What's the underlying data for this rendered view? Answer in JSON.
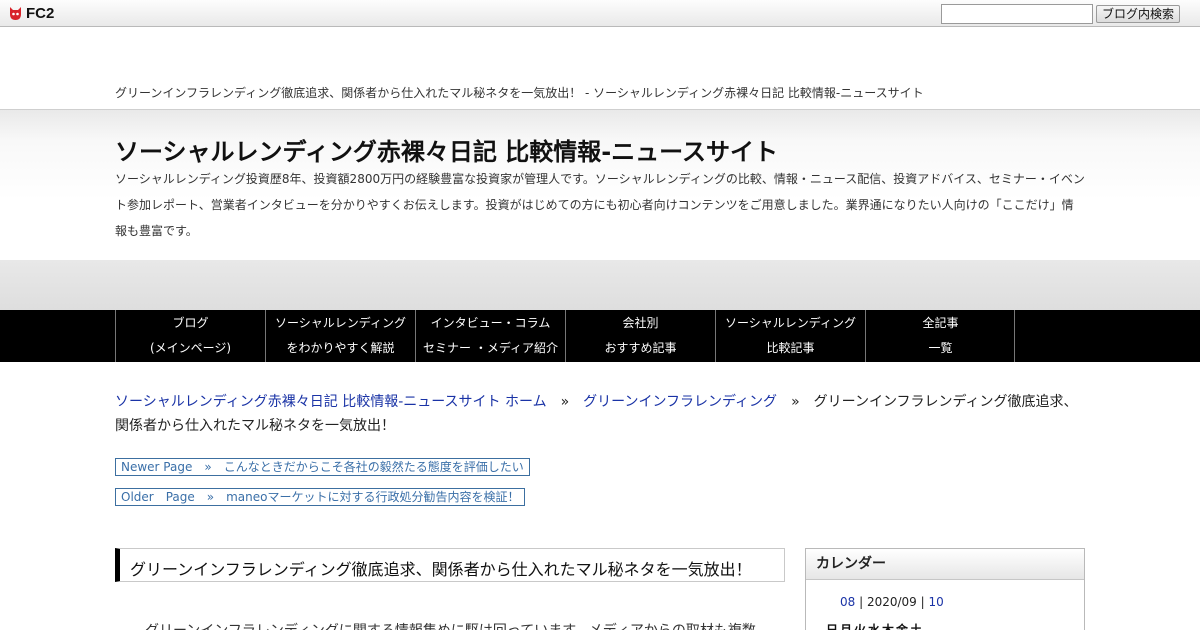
{
  "fc2": {
    "logo_text": "FC2",
    "search_placeholder": "",
    "search_button": "ブログ内検索"
  },
  "page_title": "グリーンインフラレンディング徹底追求、関係者から仕入れたマル秘ネタを一気放出！ - ソーシャルレンディング赤裸々日記 比較情報-ニュースサイト",
  "header": {
    "blog_title": "ソーシャルレンディング赤裸々日記 比較情報-ニュースサイト",
    "description": "ソーシャルレンディング投資歴8年、投資額2800万円の経験豊富な投資家が管理人です。ソーシャルレンディングの比較、情報・ニュース配信、投資アドバイス、セミナー・イベント参加レポート、営業者インタビューを分かりやすくお伝えします。投資がはじめての方にも初心者向けコンテンツをご用意しました。業界通になりたい人向けの「ここだけ」情報も豊富です。"
  },
  "nav": {
    "items": [
      {
        "line1": "ブログ",
        "line2": "(メインページ)"
      },
      {
        "line1": "ソーシャルレンディング",
        "line2": "をわかりやすく解説"
      },
      {
        "line1": "インタビュー・コラム",
        "line2": "セミナー ・メディア紹介"
      },
      {
        "line1": "会社別",
        "line2": "おすすめ記事"
      },
      {
        "line1": "ソーシャルレンディング",
        "line2": "比較記事"
      },
      {
        "line1": "全記事",
        "line2": "一覧"
      }
    ]
  },
  "breadcrumb": {
    "home": "ソーシャルレンディング赤裸々日記 比較情報-ニュースサイト ホーム",
    "sep": "»",
    "category": "グリーンインフラレンディング",
    "current": "グリーンインフラレンディング徹底追求、関係者から仕入れたマル秘ネタを一気放出！"
  },
  "pager": {
    "newer": "Newer Page　»　こんなときだからこそ各社の毅然たる態度を評価したい",
    "older": "Older　Page　»　maneoマーケットに対する行政処分勧告内容を検証！"
  },
  "entry": {
    "title": "グリーンインフラレンディング徹底追求、関係者から仕入れたマル秘ネタを一気放出！",
    "text_start": "グリーンインフラレンディングに関する情報集めに駆け回っています。メディアからの取材も複数"
  },
  "sidebar": {
    "calendar_title": "カレンダー",
    "prev": "08",
    "current": " | 2020/09 | ",
    "next": "10",
    "weekdays": [
      "日",
      "月",
      "火",
      "水",
      "木",
      "金",
      "土"
    ]
  }
}
